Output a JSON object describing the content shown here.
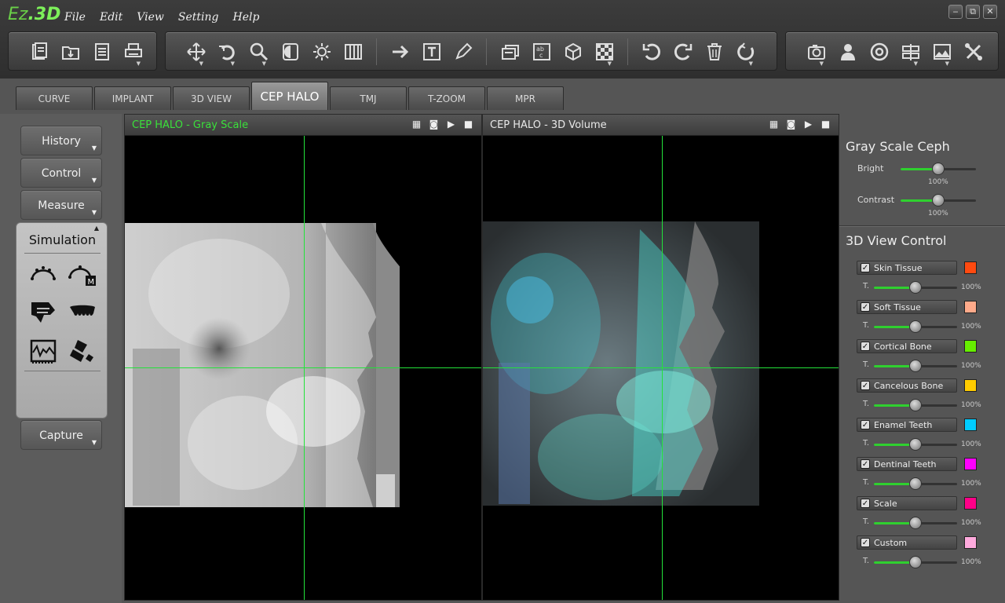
{
  "app": {
    "logo_a": "Ez",
    "logo_b": ".3D"
  },
  "menu": [
    "File",
    "Edit",
    "View",
    "Setting",
    "Help"
  ],
  "window_controls": {
    "minimize": "‒",
    "restore": "⧉",
    "close": "✕"
  },
  "toolbar_icons": [
    "new-document-icon",
    "open-folder-icon",
    "save-icon",
    "print-icon",
    "move-icon",
    "rotate-icon",
    "zoom-icon",
    "contrast-icon",
    "brightness-icon",
    "columns-icon",
    "arrow-icon",
    "text-icon",
    "pen-icon",
    "layers-icon",
    "abc-icon",
    "cube-icon",
    "checker-icon",
    "undo-icon",
    "redo-icon",
    "trash-icon",
    "reset-icon",
    "camera-icon",
    "person-icon",
    "disc-icon",
    "compare-icon",
    "image-icon",
    "tools-icon"
  ],
  "tabs": [
    "CURVE",
    "IMPLANT",
    "3D VIEW",
    "CEP HALO",
    "TMJ",
    "T-ZOOM",
    "MPR"
  ],
  "active_tab": "CEP HALO",
  "left": {
    "history": "History",
    "control": "Control",
    "measure": "Measure",
    "capture": "Capture",
    "simulation": {
      "title": "Simulation",
      "icons": [
        "arch-curve-icon",
        "arch-curve-m-icon",
        "tooth-profile-icon",
        "teeth-row-icon",
        "waveform-icon",
        "splint-tool-icon"
      ]
    }
  },
  "viewports": [
    {
      "title": "CEP HALO - Gray Scale",
      "title_color": "#3ae03a"
    },
    {
      "title": "CEP HALO - 3D Volume",
      "title_color": "#e8e8e8"
    }
  ],
  "viewport_icons": {
    "layout": "▦",
    "snapshot": "◙",
    "play": "▶",
    "maximize": "■"
  },
  "gray_scale": {
    "title": "Gray Scale Ceph",
    "bright": {
      "label": "Bright",
      "value": "100%",
      "level": 0.5
    },
    "contrast": {
      "label": "Contrast",
      "value": "100%",
      "level": 0.5
    }
  },
  "view3d": {
    "title": "3D View Control",
    "t_label": "T.",
    "layers": [
      {
        "name": "Skin Tissue",
        "color": "#ff4a10",
        "value": "100%",
        "checked": true
      },
      {
        "name": "Soft Tissue",
        "color": "#ffaa8a",
        "value": "100%",
        "checked": true
      },
      {
        "name": "Cortical Bone",
        "color": "#66ee00",
        "value": "100%",
        "checked": true
      },
      {
        "name": "Cancelous Bone",
        "color": "#ffcc00",
        "value": "100%",
        "checked": true
      },
      {
        "name": "Enamel Teeth",
        "color": "#00ccff",
        "value": "100%",
        "checked": true
      },
      {
        "name": "Dentinal Teeth",
        "color": "#ff00ff",
        "value": "100%",
        "checked": true
      },
      {
        "name": "Scale",
        "color": "#ff0088",
        "value": "100%",
        "checked": true
      },
      {
        "name": "Custom",
        "color": "#ffaadd",
        "value": "100%",
        "checked": true
      }
    ]
  }
}
